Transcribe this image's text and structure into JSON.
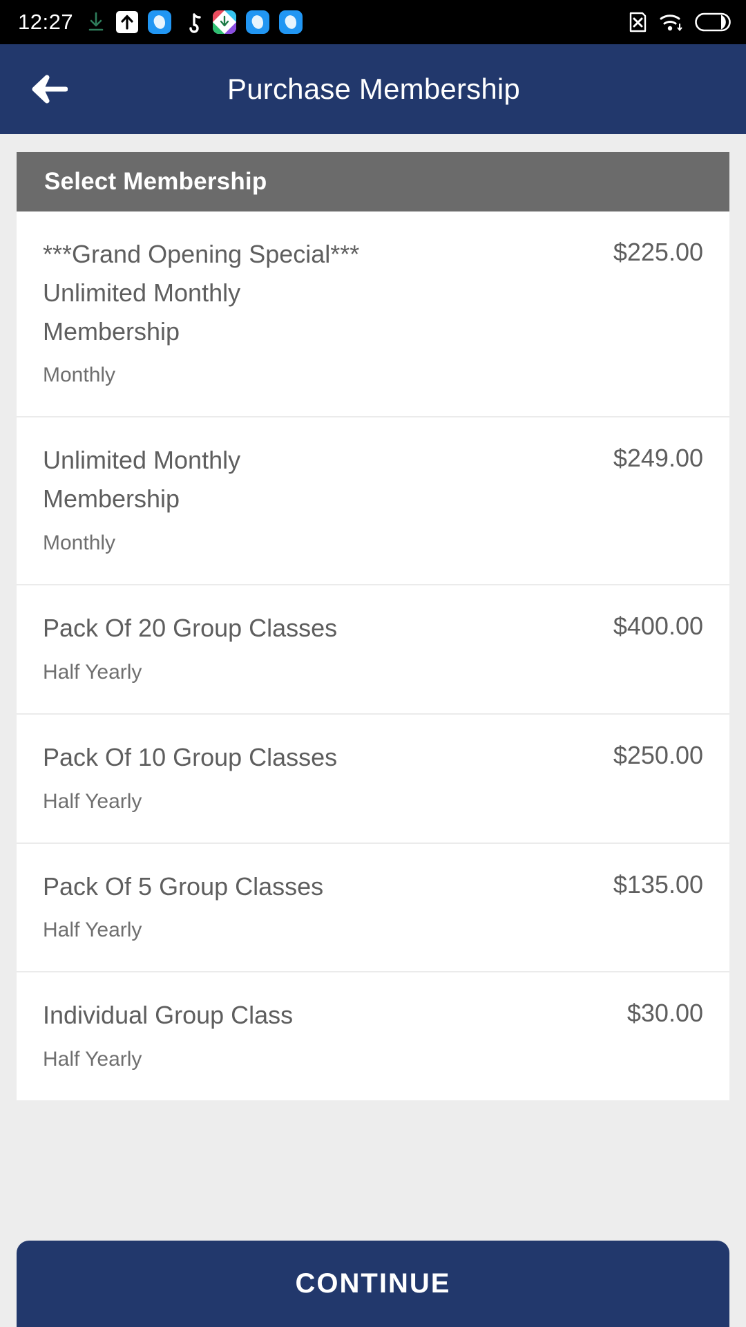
{
  "status_bar": {
    "time": "12:27",
    "left_icons": [
      "download-icon",
      "upload-box-icon",
      "messenger-app-icon",
      "tiktok-music-icon",
      "photos-app-icon",
      "messenger-app-icon-2",
      "messenger-app-icon-3"
    ],
    "right_icons": [
      "sim-card-missing-icon",
      "wifi-data-icon",
      "battery-icon"
    ]
  },
  "app_bar": {
    "back_label": "back-arrow",
    "title": "Purchase Membership"
  },
  "section": {
    "header": "Select Membership"
  },
  "memberships": [
    {
      "title": "***Grand Opening Special*** Unlimited Monthly Membership",
      "period": "Monthly",
      "price": "$225.00"
    },
    {
      "title": "Unlimited Monthly Membership",
      "period": "Monthly",
      "price": "$249.00"
    },
    {
      "title": "Pack Of 20 Group Classes",
      "period": "Half Yearly",
      "price": "$400.00"
    },
    {
      "title": "Pack Of 10 Group Classes",
      "period": "Half Yearly",
      "price": "$250.00"
    },
    {
      "title": "Pack Of 5 Group Classes",
      "period": "Half Yearly",
      "price": "$135.00"
    },
    {
      "title": "Individual Group Class",
      "period": "Half Yearly",
      "price": "$30.00"
    }
  ],
  "footer": {
    "continue_label": "CONTINUE"
  },
  "colors": {
    "brand_navy": "#22386c",
    "section_gray": "#6b6b6b",
    "page_bg": "#ededed",
    "text_gray": "#5e5e5e"
  }
}
